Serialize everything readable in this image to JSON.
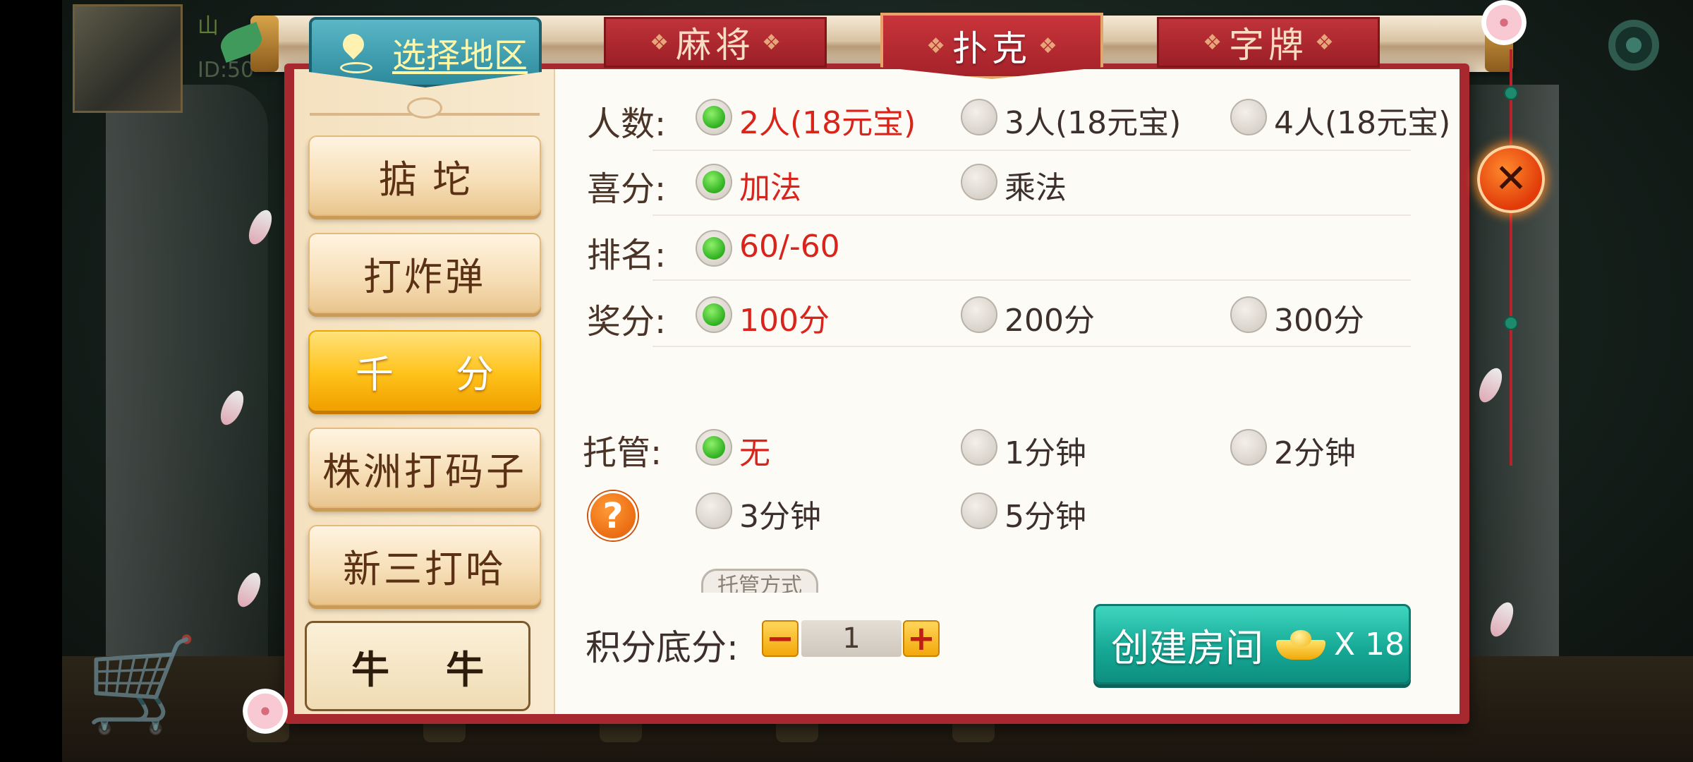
{
  "user": {
    "name": "山",
    "id": "ID:50"
  },
  "region": {
    "label": "选择地区"
  },
  "categories": [
    {
      "label": "麻将"
    },
    {
      "label": "扑克"
    },
    {
      "label": "字牌"
    }
  ],
  "games": [
    {
      "label": "掂坨"
    },
    {
      "label": "打炸弹"
    },
    {
      "label": "千分"
    },
    {
      "label": "株洲打码子"
    },
    {
      "label": "新三打哈"
    },
    {
      "label": "牛牛"
    }
  ],
  "active_game": "千分",
  "active_category": "扑克",
  "options": {
    "players": {
      "label": "人数:",
      "choices": [
        "2人(18元宝)",
        "3人(18元宝)",
        "4人(18元宝)"
      ],
      "selected": "2人(18元宝)"
    },
    "bonus_mode": {
      "label": "喜分:",
      "choices": [
        "加法",
        "乘法"
      ],
      "selected": "加法"
    },
    "ranking": {
      "label": "排名:",
      "choices": [
        "60/-60"
      ],
      "selected": "60/-60"
    },
    "reward": {
      "label": "奖分:",
      "choices": [
        "100分",
        "200分",
        "300分"
      ],
      "selected": "100分"
    },
    "auto_play": {
      "label": "托管:",
      "choices": [
        "无",
        "1分钟",
        "2分钟",
        "3分钟",
        "5分钟"
      ],
      "selected": "无"
    }
  },
  "auto_play_mode_label": "托管方式",
  "help_icon_glyph": "?",
  "score": {
    "label": "积分底分:",
    "value": "1",
    "minus": "−",
    "plus": "+"
  },
  "create": {
    "label": "创建房间",
    "cost": "X 18"
  },
  "close_glyph": "✕",
  "colors": {
    "selected_text": "#d9241c",
    "panel_border": "#a7282e",
    "create_button": "#17aa96",
    "active_game": "#ffc21a"
  },
  "icons": [
    "location-pin-icon",
    "gold-ingot-icon",
    "help-icon",
    "close-icon",
    "gear-icon"
  ]
}
